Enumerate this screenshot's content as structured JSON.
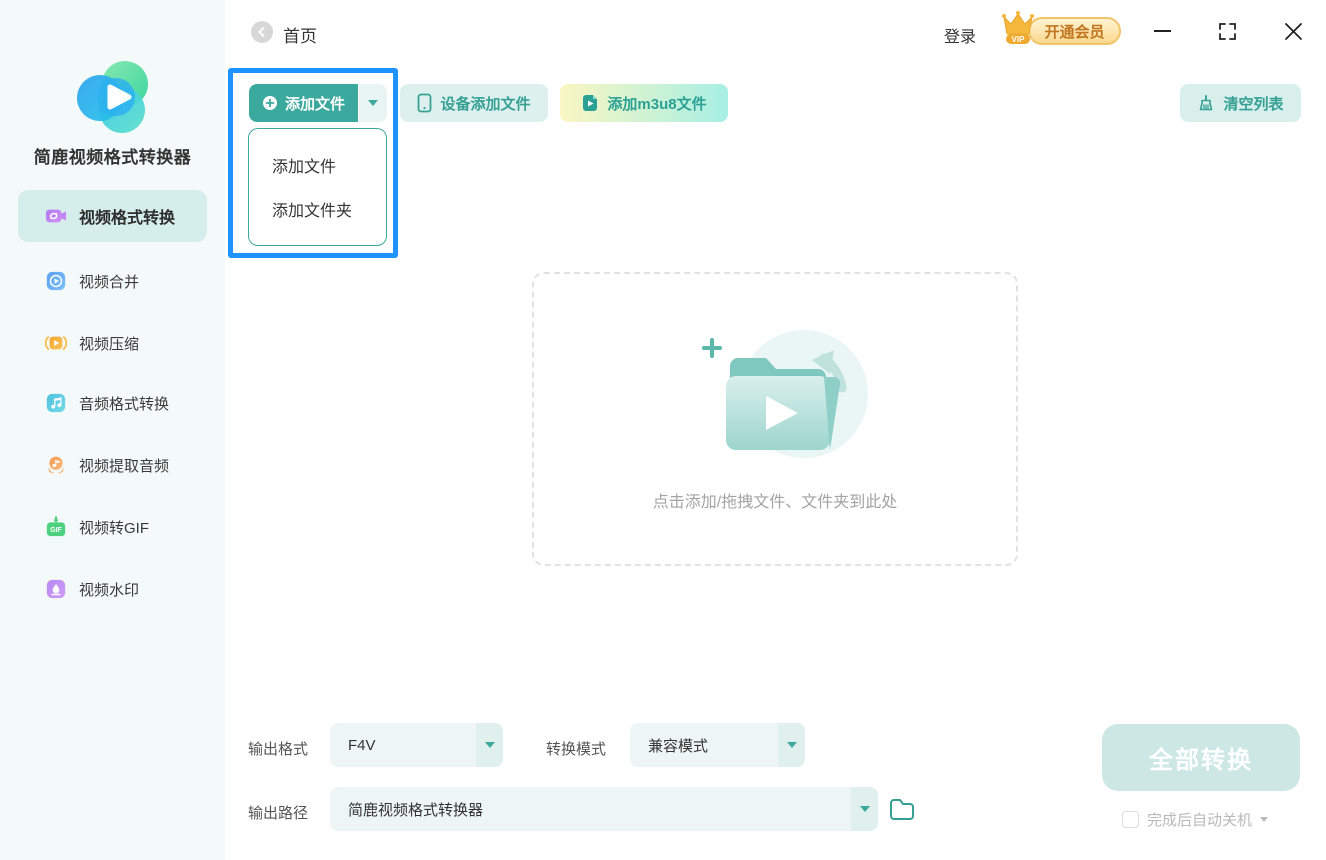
{
  "app_title": "简鹿视频格式转换器",
  "titlebar": {
    "home": "首页",
    "login": "登录",
    "vip_badge": "VIP",
    "vip_text": "开通会员"
  },
  "sidebar": {
    "items": [
      {
        "label": "视频格式转换",
        "active": true
      },
      {
        "label": "视频合并",
        "active": false
      },
      {
        "label": "视频压缩",
        "active": false
      },
      {
        "label": "音频格式转换",
        "active": false
      },
      {
        "label": "视频提取音频",
        "active": false
      },
      {
        "label": "视频转GIF",
        "active": false
      },
      {
        "label": "视频水印",
        "active": false
      }
    ]
  },
  "toolbar": {
    "add_file": "添加文件",
    "device_add": "设备添加文件",
    "add_m3u8": "添加m3u8文件",
    "clear_list": "清空列表"
  },
  "add_menu": {
    "items": [
      {
        "label": "添加文件"
      },
      {
        "label": "添加文件夹"
      }
    ]
  },
  "dropzone": {
    "hint": "点击添加/拖拽文件、文件夹到此处"
  },
  "output": {
    "format_label": "输出格式",
    "format_value": "F4V",
    "mode_label": "转换模式",
    "mode_value": "兼容模式",
    "path_label": "输出路径",
    "path_value": "简鹿视频格式转换器"
  },
  "actions": {
    "convert_all": "全部转换",
    "auto_shutdown": "完成后自动关机"
  },
  "colors": {
    "primary_teal": "#3ca99e",
    "annotation_blue": "#1e93ff",
    "vip_gold": "#c0761f",
    "sidebar_bg": "#f4faf9",
    "active_item_bg": "#d6eeeb"
  }
}
